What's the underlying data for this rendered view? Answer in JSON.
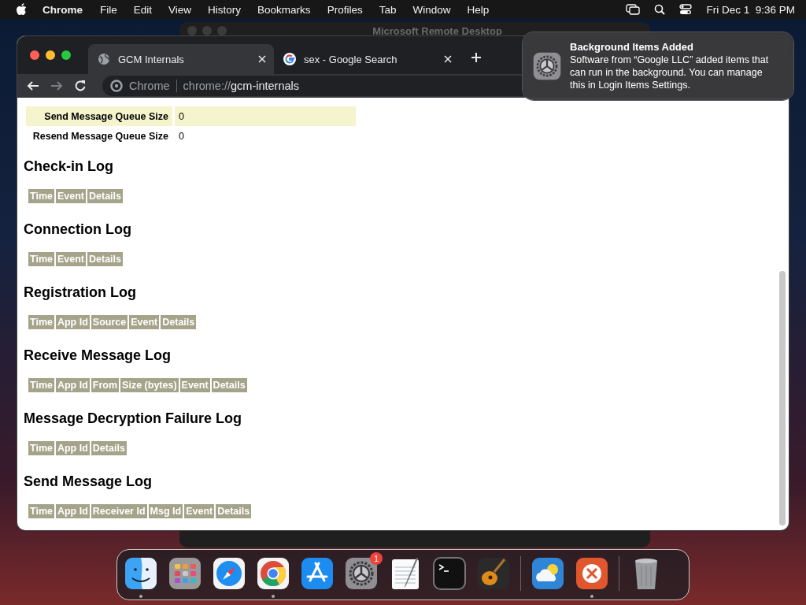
{
  "menu_bar": {
    "app_name": "Chrome",
    "menus": [
      "File",
      "Edit",
      "View",
      "History",
      "Bookmarks",
      "Profiles",
      "Tab",
      "Window",
      "Help"
    ],
    "clock": "Fri Dec 1  9:36 PM"
  },
  "background_window": {
    "title": "Microsoft Remote Desktop"
  },
  "browser": {
    "tabs": [
      {
        "title": "GCM Internals",
        "kind": "globe",
        "selected": true
      },
      {
        "title": "sex - Google Search",
        "kind": "google",
        "selected": false
      }
    ],
    "site_chip": "Chrome",
    "url": "chrome://gcm-internals",
    "status_rows": [
      {
        "label": "Send Message Queue Size",
        "value": "0",
        "highlighted": true
      },
      {
        "label": "Resend Message Queue Size",
        "value": "0",
        "highlighted": false
      }
    ],
    "logs": [
      {
        "title": "Check-in Log",
        "columns": [
          "Time",
          "Event",
          "Details"
        ]
      },
      {
        "title": "Connection Log",
        "columns": [
          "Time",
          "Event",
          "Details"
        ]
      },
      {
        "title": "Registration Log",
        "columns": [
          "Time",
          "App Id",
          "Source",
          "Event",
          "Details"
        ]
      },
      {
        "title": "Receive Message Log",
        "columns": [
          "Time",
          "App Id",
          "From",
          "Size (bytes)",
          "Event",
          "Details"
        ]
      },
      {
        "title": "Message Decryption Failure Log",
        "columns": [
          "Time",
          "App Id",
          "Details"
        ]
      },
      {
        "title": "Send Message Log",
        "columns": [
          "Time",
          "App Id",
          "Receiver Id",
          "Msg Id",
          "Event",
          "Details"
        ]
      }
    ]
  },
  "notification": {
    "title": "Background Items Added",
    "body": "Software from “Google LLC” added items that can run in the background. You can manage this in Login Items Settings."
  },
  "dock": {
    "items": [
      {
        "kind": "finder",
        "running": true
      },
      {
        "kind": "launchpad",
        "running": false
      },
      {
        "kind": "safari",
        "running": false
      },
      {
        "kind": "chrome",
        "running": true
      },
      {
        "kind": "appstore",
        "running": false
      },
      {
        "kind": "settings",
        "running": false,
        "badge": "1"
      },
      {
        "kind": "textedit",
        "running": false
      },
      {
        "kind": "terminal",
        "running": false
      },
      {
        "kind": "garageband",
        "running": false
      },
      {
        "kind": "separator"
      },
      {
        "kind": "weather",
        "running": false
      },
      {
        "kind": "remote",
        "running": true
      },
      {
        "kind": "separator"
      },
      {
        "kind": "trash",
        "running": false
      }
    ]
  }
}
